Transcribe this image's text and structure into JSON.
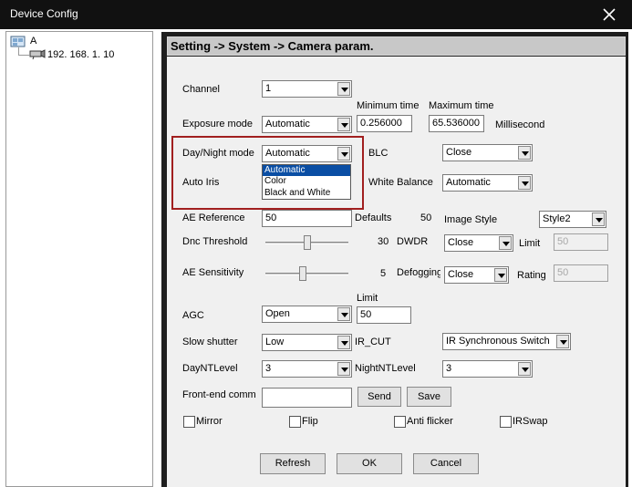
{
  "window": {
    "title": "Device Config"
  },
  "tree": {
    "root_label": "A",
    "device_label": "192. 168. 1. 10"
  },
  "panel": {
    "header": "Setting -> System -> Camera param."
  },
  "form": {
    "channel": {
      "label": "Channel",
      "value": "1"
    },
    "exposure": {
      "label": "Exposure mode",
      "value": "Automatic",
      "min_time_header": "Minimum time",
      "max_time_header": "Maximum time",
      "min_time": "0.256000",
      "max_time": "65.536000",
      "unit": "Millisecond"
    },
    "day_night": {
      "label": "Day/Night mode",
      "value": "Automatic",
      "options": [
        "Automatic",
        "Color",
        "Black and White"
      ]
    },
    "blc": {
      "label": "BLC",
      "value": "Close"
    },
    "auto_iris": {
      "label": "Auto Iris"
    },
    "white_balance": {
      "label": "White Balance",
      "value": "Automatic"
    },
    "ae_reference": {
      "label": "AE Reference",
      "value": "50",
      "defaults_label": "Defaults",
      "defaults_value": "50"
    },
    "image_style": {
      "label": "Image Style",
      "value": "Style2"
    },
    "dnc_threshold": {
      "label": "Dnc Threshold",
      "value": "30",
      "level": 0.5
    },
    "dwdr": {
      "label": "DWDR",
      "value": "Close",
      "limit_label": "Limit",
      "limit_value": "50"
    },
    "ae_sensitivity": {
      "label": "AE Sensitivity",
      "value": "5",
      "level": 0.45
    },
    "defogging": {
      "label": "Defogging",
      "value": "Close",
      "rating_label": "Rating",
      "rating_value": "50"
    },
    "agc": {
      "label": "AGC",
      "value": "Open",
      "limit_label": "Limit",
      "limit_value": "50"
    },
    "slow_shutter": {
      "label": "Slow shutter",
      "value": "Low"
    },
    "ir_cut": {
      "label": "IR_CUT",
      "value": "IR Synchronous Switch"
    },
    "day_nt_level": {
      "label": "DayNTLevel",
      "value": "3"
    },
    "night_nt_level": {
      "label": "NightNTLevel",
      "value": "3"
    },
    "front_end": {
      "label": "Front-end comm",
      "value": "",
      "send_label": "Send",
      "save_label": "Save"
    },
    "checkboxes": {
      "mirror": "Mirror",
      "flip": "Flip",
      "anti_flicker": "Anti flicker",
      "irswap": "IRSwap"
    }
  },
  "footer": {
    "refresh": "Refresh",
    "ok": "OK",
    "cancel": "Cancel"
  },
  "colors": {
    "titlebar": "#111111",
    "panel_frame": "#1e1e1e",
    "highlight": "#a11f1f",
    "selection": "#0a4ea4"
  }
}
